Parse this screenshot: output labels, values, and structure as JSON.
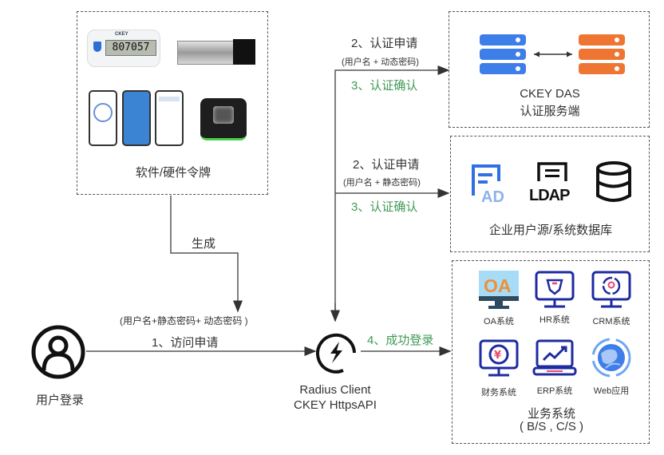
{
  "token_box": {
    "label": "软件/硬件令牌",
    "otp_display": "807057",
    "otp_brand": "CKEY"
  },
  "das_box": {
    "title_line1": "CKEY DAS",
    "title_line2": "认证服务端"
  },
  "user_source_box": {
    "label": "企业用户源/系统数据库",
    "icons": [
      "AD",
      "LDAP",
      "database"
    ]
  },
  "business_box": {
    "title_line1": "业务系统",
    "title_line2": "( B/S , C/S )",
    "systems": [
      {
        "name": "OA系统",
        "icon": "oa-monitor"
      },
      {
        "name": "HR系统",
        "icon": "hr-monitor"
      },
      {
        "name": "CRM系统",
        "icon": "crm-monitor"
      },
      {
        "name": "财务系统",
        "icon": "finance-monitor"
      },
      {
        "name": "ERP系统",
        "icon": "erp-laptop"
      },
      {
        "name": "Web应用",
        "icon": "globe"
      }
    ]
  },
  "user": {
    "label": "用户登录"
  },
  "radius": {
    "line1": "Radius Client",
    "line2": "CKEY HttpsAPI"
  },
  "flows": {
    "generate": "生成",
    "credentials": "(用户名+静态密码+ 动态密码 )",
    "step1": "1、访问申请",
    "step2a": "2、认证申请",
    "step2a_sub": "(用户名 + 动态密码)",
    "step3a": "3、认证确认",
    "step2b": "2、认证申请",
    "step2b_sub": "(用户名 + 静态密码)",
    "step3b": "3、认证确认",
    "step4": "4、成功登录"
  },
  "colors": {
    "green": "#3f9a55",
    "blue_server": "#3d7ee8",
    "orange_server": "#ef7533",
    "navy_icon": "#1e2ba0"
  }
}
